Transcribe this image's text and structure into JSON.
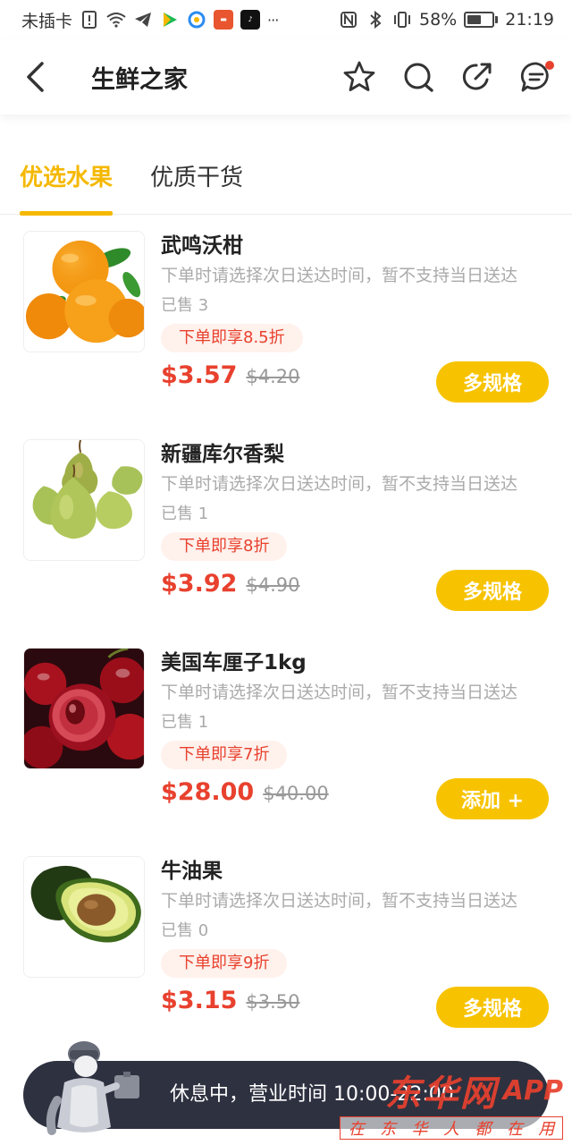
{
  "status_bar": {
    "carrier": "未插卡",
    "battery": "58%",
    "time": "21:19",
    "battery_level": 0.58,
    "icons": [
      "sim-alert-icon",
      "wifi-icon",
      "telegram-icon",
      "video-app-icon",
      "browser-app-icon",
      "news-app-icon",
      "tiktok-icon",
      "more-icon",
      "nfc-icon",
      "bluetooth-icon",
      "vibrate-icon",
      "battery-icon"
    ],
    "more": "···"
  },
  "header": {
    "title": "生鲜之家",
    "icons": [
      "back-arrow-icon",
      "star-icon",
      "search-icon",
      "share-icon",
      "message-icon"
    ]
  },
  "tabs": [
    {
      "label": "优选水果",
      "active": true
    },
    {
      "label": "优质干货",
      "active": false
    }
  ],
  "products": [
    {
      "name": "武鸣沃柑",
      "desc": "下单时请选择次日送达时间，暂不支持当日送达",
      "sold": "已售 3",
      "discount": "下单即享8.5折",
      "price": "$3.57",
      "original_price": "$4.20",
      "button": "多规格",
      "image": "orange-image"
    },
    {
      "name": "新疆库尔香梨",
      "desc": "下单时请选择次日送达时间，暂不支持当日送达",
      "sold": "已售 1",
      "discount": "下单即享8折",
      "price": "$3.92",
      "original_price": "$4.90",
      "button": "多规格",
      "image": "pear-image"
    },
    {
      "name": "美国车厘子1kg",
      "desc": "下单时请选择次日送达时间，暂不支持当日送达",
      "sold": "已售 1",
      "discount": "下单即享7折",
      "price": "$28.00",
      "original_price": "$40.00",
      "button": "添加 +",
      "image": "cherry-image"
    },
    {
      "name": "牛油果",
      "desc": "下单时请选择次日送达时间，暂不支持当日送达",
      "sold": "已售 0",
      "discount": "下单即享9折",
      "price": "$3.15",
      "original_price": "$3.50",
      "button": "多规格",
      "image": "avocado-image"
    }
  ],
  "closed_banner": {
    "text": "休息中，营业时间 10:00-22:00"
  },
  "watermark": {
    "brand_cn": "东华网",
    "brand_en": "APP",
    "slogan": [
      "在",
      "东",
      "华",
      "人",
      "都",
      "在",
      "用"
    ]
  },
  "colors": {
    "accent": "#f5b800",
    "price": "#e8412e",
    "banner_bg": "#2e3140"
  }
}
